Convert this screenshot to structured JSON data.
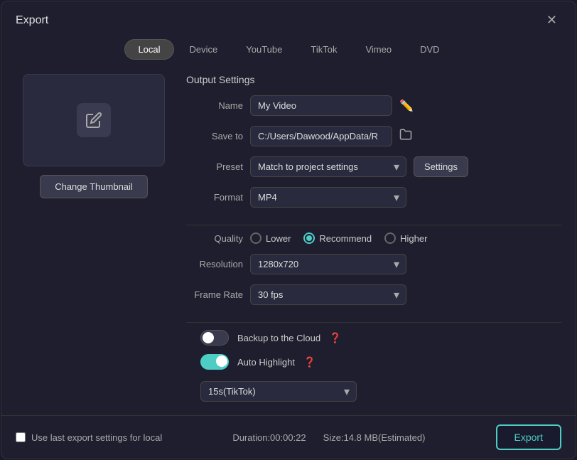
{
  "dialog": {
    "title": "Export",
    "close_label": "✕"
  },
  "tabs": [
    {
      "id": "local",
      "label": "Local",
      "active": true
    },
    {
      "id": "device",
      "label": "Device",
      "active": false
    },
    {
      "id": "youtube",
      "label": "YouTube",
      "active": false
    },
    {
      "id": "tiktok",
      "label": "TikTok",
      "active": false
    },
    {
      "id": "vimeo",
      "label": "Vimeo",
      "active": false
    },
    {
      "id": "dvd",
      "label": "DVD",
      "active": false
    }
  ],
  "thumbnail": {
    "change_label": "Change Thumbnail"
  },
  "output_settings": {
    "section_title": "Output Settings",
    "name_label": "Name",
    "name_value": "My Video",
    "save_to_label": "Save to",
    "save_to_value": "C:/Users/Dawood/AppData/R",
    "preset_label": "Preset",
    "preset_value": "Match to project settings",
    "settings_label": "Settings",
    "format_label": "Format",
    "format_value": "MP4",
    "quality_label": "Quality",
    "quality_options": [
      {
        "id": "lower",
        "label": "Lower",
        "checked": false
      },
      {
        "id": "recommend",
        "label": "Recommend",
        "checked": true
      },
      {
        "id": "higher",
        "label": "Higher",
        "checked": false
      }
    ],
    "resolution_label": "Resolution",
    "resolution_value": "1280x720",
    "frame_rate_label": "Frame Rate",
    "frame_rate_value": "30 fps",
    "backup_label": "Backup to the Cloud",
    "backup_on": false,
    "auto_highlight_label": "Auto Highlight",
    "auto_highlight_on": true,
    "highlight_duration": "15s(TikTok)"
  },
  "footer": {
    "use_last_label": "Use last export settings for local",
    "duration_label": "Duration:00:00:22",
    "size_label": "Size:14.8 MB(Estimated)",
    "export_label": "Export"
  }
}
